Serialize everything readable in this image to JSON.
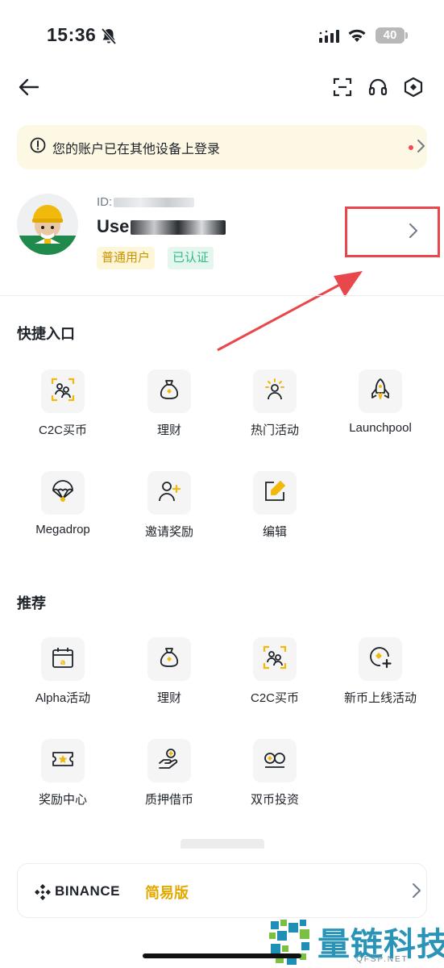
{
  "status_bar": {
    "time": "15:36",
    "battery": "40"
  },
  "banner": {
    "text": "您的账户已在其他设备上登录"
  },
  "profile": {
    "id_prefix": "ID:",
    "name_prefix": "Use",
    "tags": [
      "普通用户",
      "已认证"
    ]
  },
  "quick_access": {
    "title": "快捷入口",
    "items": [
      {
        "label": "C2C买币",
        "icon": "c2c-users-icon"
      },
      {
        "label": "理财",
        "icon": "money-bag-icon"
      },
      {
        "label": "热门活动",
        "icon": "hot-activity-icon"
      },
      {
        "label": "Launchpool",
        "icon": "rocket-icon"
      },
      {
        "label": "Megadrop",
        "icon": "parachute-icon"
      },
      {
        "label": "邀请奖励",
        "icon": "invite-user-icon"
      },
      {
        "label": "编辑",
        "icon": "edit-icon"
      }
    ]
  },
  "recommended": {
    "title": "推荐",
    "items": [
      {
        "label": "Alpha活动",
        "icon": "alpha-calendar-icon"
      },
      {
        "label": "理财",
        "icon": "money-bag-icon"
      },
      {
        "label": "C2C买币",
        "icon": "c2c-users-icon"
      },
      {
        "label": "新币上线活动",
        "icon": "new-coin-icon"
      },
      {
        "label": "奖励中心",
        "icon": "ticket-star-icon"
      },
      {
        "label": "质押借币",
        "icon": "hand-coin-icon"
      },
      {
        "label": "双币投资",
        "icon": "dual-coin-icon"
      }
    ]
  },
  "binance_card": {
    "brand": "BINANCE",
    "mode": "简易版"
  },
  "watermark": {
    "text": "量链科技",
    "url": "QFSP.NET"
  },
  "colors": {
    "accent": "#F0B90B",
    "annotation": "#E8474B",
    "verified": "#2EBD85"
  }
}
